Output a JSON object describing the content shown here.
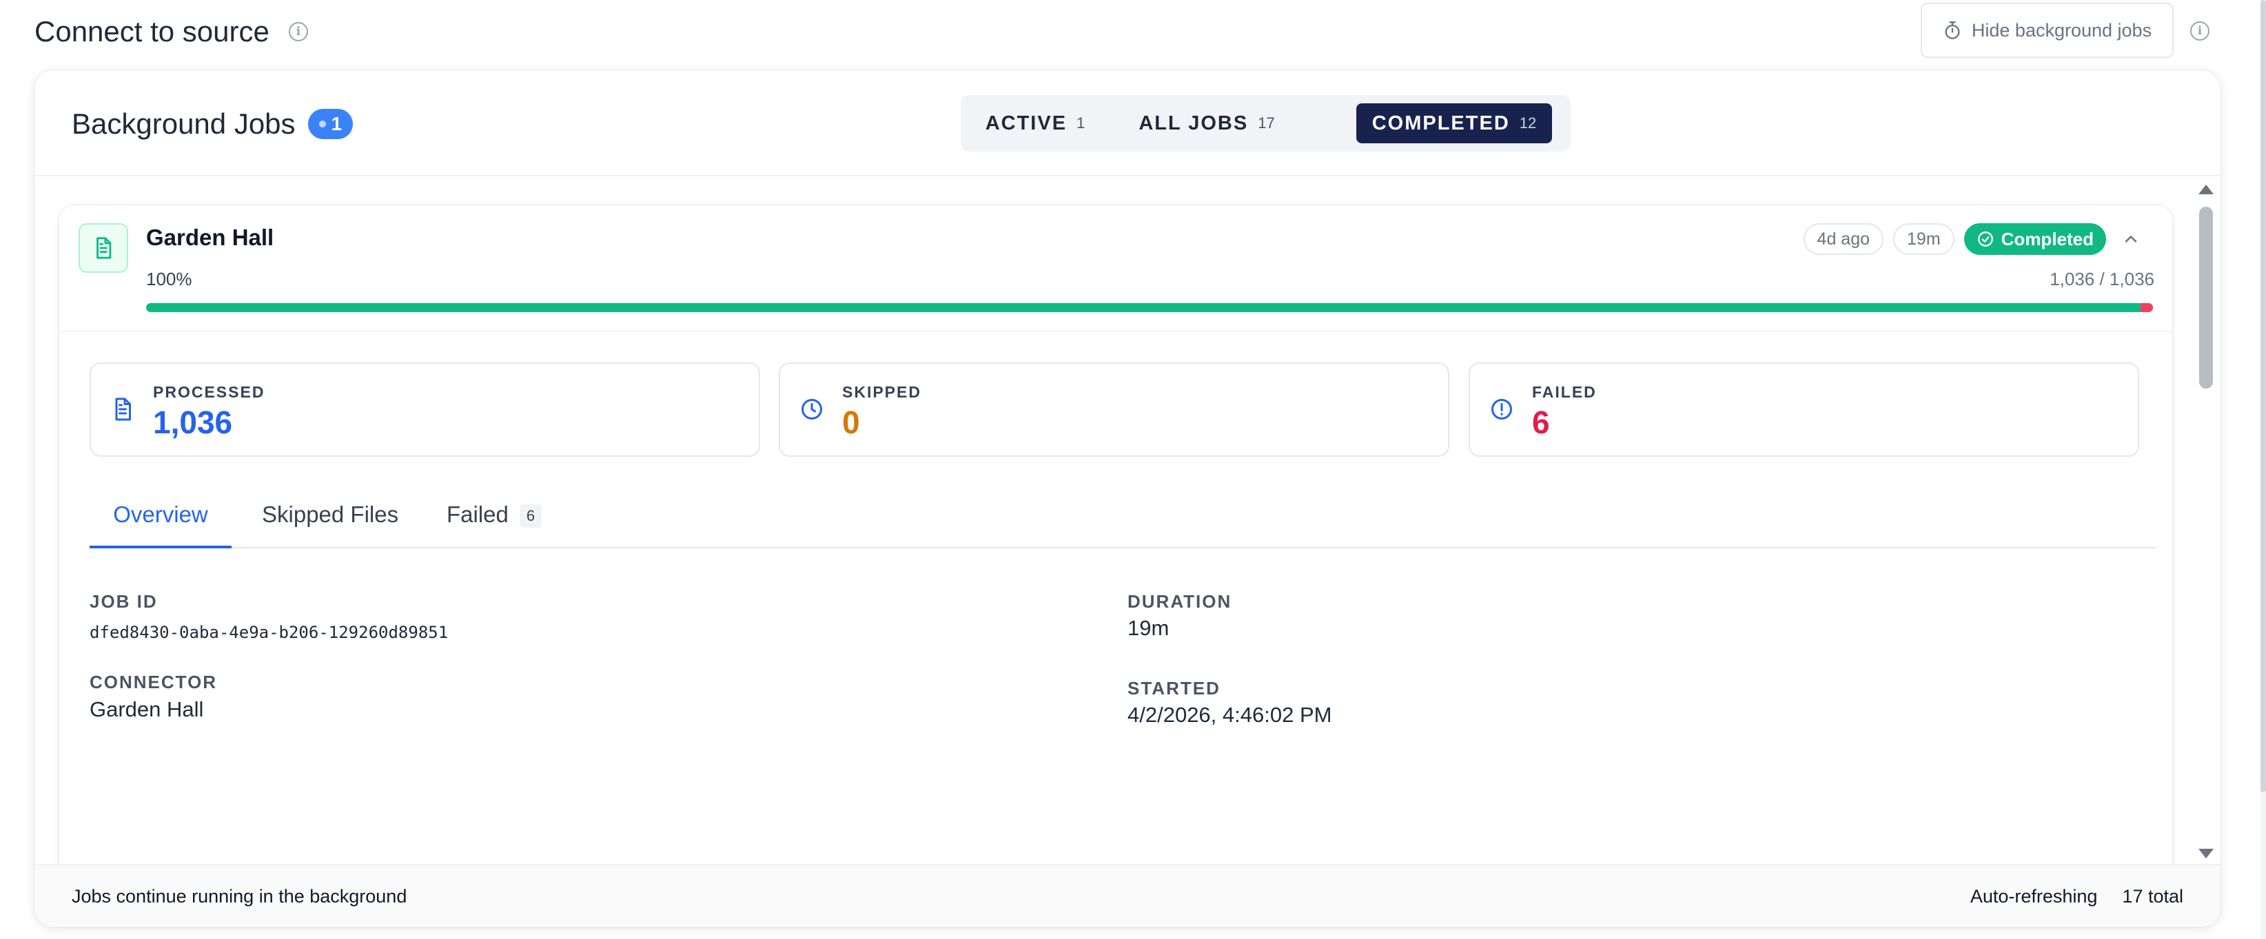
{
  "header": {
    "title": "Connect to source",
    "hide_jobs_label": "Hide background jobs"
  },
  "panel": {
    "title": "Background Jobs",
    "active_count": "1",
    "filters": [
      {
        "label": "ACTIVE",
        "count": "1"
      },
      {
        "label": "ALL JOBS",
        "count": "17"
      },
      {
        "label": "COMPLETED",
        "count": "12"
      }
    ],
    "selected_filter": "COMPLETED"
  },
  "job": {
    "name": "Garden Hall",
    "progress_percent": "100%",
    "progress_fraction": 1.0,
    "progress_ratio": "1,036 / 1,036",
    "age": "4d ago",
    "duration_chip": "19m",
    "status": "Completed",
    "stats": {
      "processed": {
        "label": "PROCESSED",
        "value": "1,036"
      },
      "skipped": {
        "label": "SKIPPED",
        "value": "0"
      },
      "failed": {
        "label": "FAILED",
        "value": "6"
      }
    },
    "tabs": [
      {
        "label": "Overview"
      },
      {
        "label": "Skipped Files"
      },
      {
        "label": "Failed",
        "badge": "6"
      }
    ],
    "details": {
      "job_id_label": "JOB ID",
      "job_id": "dfed8430-0aba-4e9a-b206-129260d89851",
      "connector_label": "CONNECTOR",
      "connector": "Garden Hall",
      "duration_label": "DURATION",
      "duration": "19m",
      "started_label": "STARTED",
      "started": "4/2/2026, 4:46:02 PM"
    }
  },
  "footer": {
    "left": "Jobs continue running in the background",
    "refresh": "Auto-refreshing",
    "total": "17 total"
  },
  "colors": {
    "accent_blue": "#2563eb",
    "success_green": "#10b981",
    "skipped_orange": "#d97706",
    "failed_red": "#e11d48",
    "selected_filter_bg": "#17234e"
  },
  "icons": {
    "info": "info-icon",
    "timer": "stopwatch-icon",
    "document": "document-icon",
    "clock": "clock-icon",
    "alert": "alert-circle-icon",
    "check": "check-circle-icon",
    "chevron": "chevron-up-icon"
  }
}
